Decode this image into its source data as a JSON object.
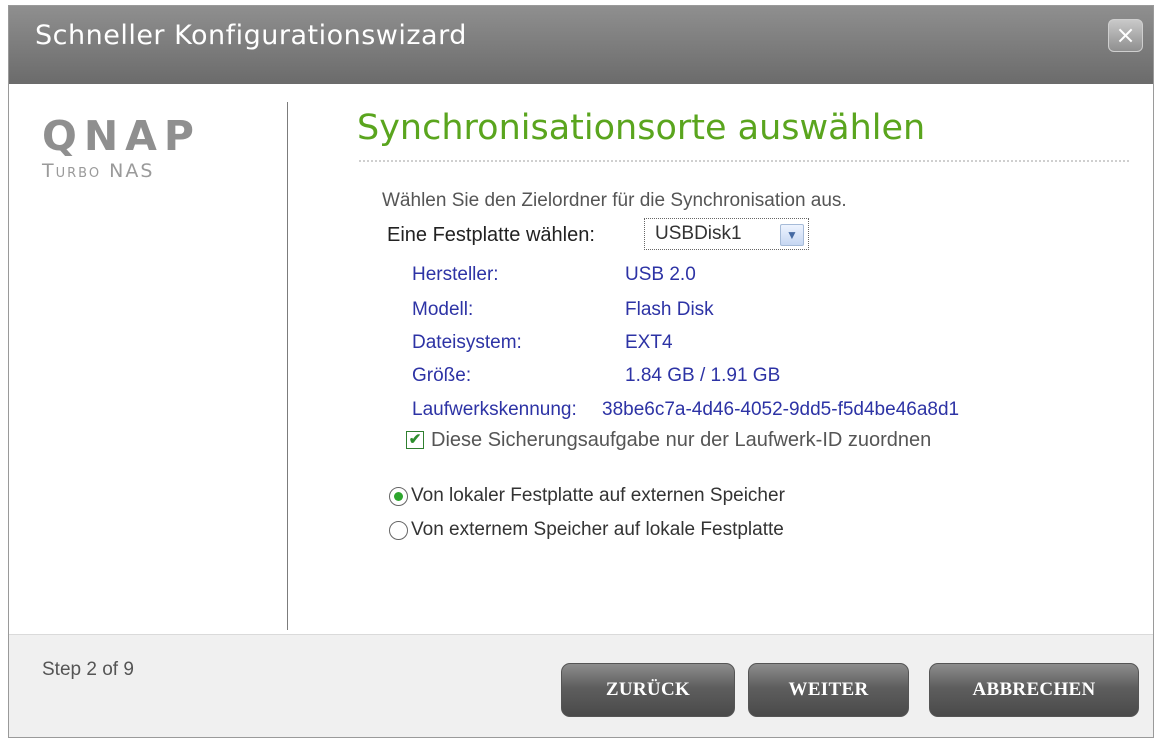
{
  "dialog": {
    "title": "Schneller Konfigurationswizard",
    "close_label": "×"
  },
  "logo": {
    "main": "QNAP",
    "sub": "Turbo NAS"
  },
  "page": {
    "heading": "Synchronisationsorte auswählen",
    "instruction": "Wählen Sie den Zielordner für die Synchronisation aus."
  },
  "disk": {
    "label": "Eine Festplatte wählen:",
    "selected": "USBDisk1",
    "arrow": "▼"
  },
  "info": {
    "manufacturer_label": "Hersteller:",
    "manufacturer_value": "USB 2.0",
    "model_label": "Modell:",
    "model_value": "Flash Disk",
    "filesystem_label": "Dateisystem:",
    "filesystem_value": "EXT4",
    "size_label": "Größe:",
    "size_value": "1.84 GB / 1.91 GB",
    "drive_id_label": "Laufwerkskennung:",
    "drive_id_value": "38be6c7a-4d46-4052-9dd5-f5d4be46a8d1"
  },
  "assign_checkbox": {
    "label": "Diese Sicherungsaufgabe nur der Laufwerk-ID zuordnen",
    "checked": true,
    "mark": "✔"
  },
  "direction": {
    "options": [
      {
        "label": "Von lokaler Festplatte auf externen Speicher",
        "selected": true
      },
      {
        "label": "Von externem Speicher auf lokale Festplatte",
        "selected": false
      }
    ]
  },
  "footer": {
    "step": "Step 2 of 9",
    "back": "ZURÜCK",
    "next": "WEITER",
    "cancel": "ABBRECHEN"
  },
  "colors": {
    "heading": "#5aa51e",
    "info_text": "#2d33a5",
    "titlebar": "#7d7d7d",
    "radio_selected": "#2ea62e"
  }
}
